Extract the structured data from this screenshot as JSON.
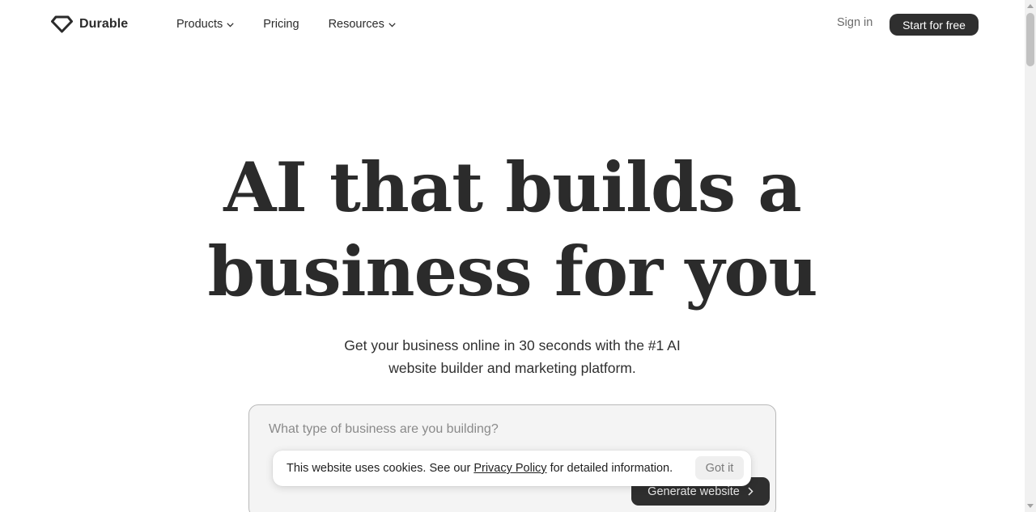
{
  "header": {
    "brand": "Durable",
    "logo_icon": "diamond-logo-icon",
    "nav": {
      "products": "Products",
      "pricing": "Pricing",
      "resources": "Resources"
    },
    "sign_in": "Sign in",
    "start_free": "Start for free"
  },
  "hero": {
    "title_line1": "AI that builds a",
    "title_line2": "business for you",
    "subtitle_line1": "Get your business online in 30 seconds with the #1 AI",
    "subtitle_line2": "website builder and marketing platform."
  },
  "generator": {
    "placeholder": "What type of business are you building?",
    "value": "",
    "button_label": "Generate website",
    "button_icon": "chevron-right-icon"
  },
  "cookie_banner": {
    "text_before": "This website uses cookies. See our ",
    "link_label": "Privacy Policy",
    "text_after": " for detailed information.",
    "button_label": "Got it"
  },
  "colors": {
    "text": "#2b2b2b",
    "button_dark": "#2f2f2f",
    "card_background": "#f4f4f4",
    "muted": "#6b6b6b"
  }
}
